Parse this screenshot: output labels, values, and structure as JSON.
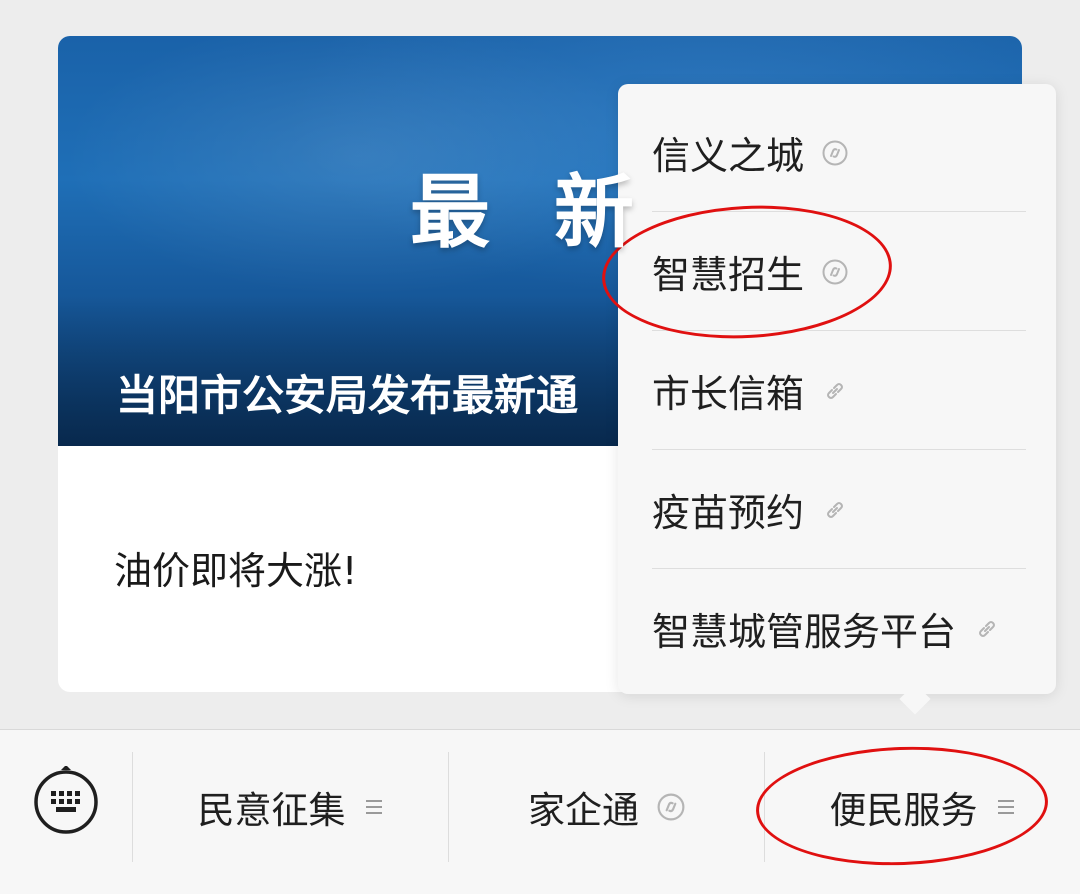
{
  "article": {
    "banner_big_text": "最新",
    "banner_caption": "当阳市公安局发布最新通",
    "title": "油价即将大涨!"
  },
  "popup_menu": {
    "items": [
      {
        "label": "信义之城",
        "icon": "mini-program-icon"
      },
      {
        "label": "智慧招生",
        "icon": "mini-program-icon"
      },
      {
        "label": "市长信箱",
        "icon": "link-icon"
      },
      {
        "label": "疫苗预约",
        "icon": "link-icon"
      },
      {
        "label": "智慧城管服务平台",
        "icon": "link-icon"
      }
    ]
  },
  "bottom_bar": {
    "keyboard_icon": "keyboard-icon",
    "tabs": [
      {
        "label": "民意征集",
        "icon": "menu-icon"
      },
      {
        "label": "家企通",
        "icon": "mini-program-icon"
      },
      {
        "label": "便民服务",
        "icon": "menu-icon"
      }
    ]
  },
  "colors": {
    "annotation": "#e01010",
    "banner": "#1f6fb7",
    "bar_background": "#f7f7f7"
  }
}
